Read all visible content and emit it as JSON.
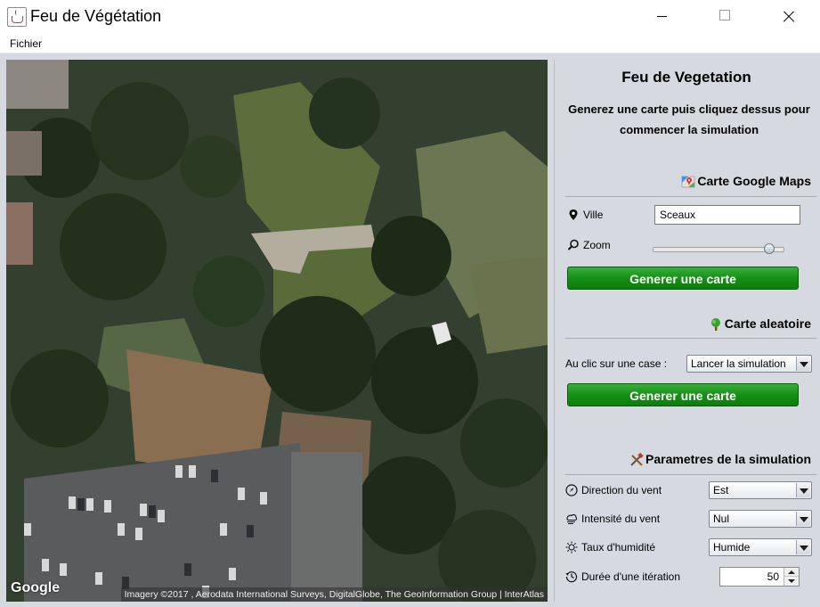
{
  "window": {
    "title": "Feu de Végétation",
    "app_icon": "java-cup-icon",
    "controls": [
      "minimize-icon",
      "maximize-icon",
      "close-icon"
    ]
  },
  "menu": {
    "items": [
      "Fichier"
    ]
  },
  "map": {
    "logo": "Google",
    "attribution": "Imagery ©2017 , Aerodata International Surveys, DigitalGlobe, The GeoInformation Group | InterAtlas"
  },
  "panel": {
    "title": "Feu de Vegetation",
    "description_line1": "Generez une carte puis cliquez dessus pour",
    "description_line2": "commencer la simulation",
    "google_section": {
      "title": "Carte Google Maps",
      "icon": "google-maps-icon",
      "city_label": "Ville",
      "city_value": "Sceaux",
      "zoom_label": "Zoom",
      "zoom_level_fraction": 0.93,
      "button": "Generer une carte"
    },
    "random_section": {
      "title": "Carte aleatoire",
      "icon": "tree-icon",
      "click_label": "Au clic sur une case :",
      "click_value": "Lancer la simulation",
      "button": "Generer une carte"
    },
    "params_section": {
      "title": "Parametres de la simulation",
      "icon": "tools-icon",
      "wind_dir_label": "Direction du vent",
      "wind_dir_value": "Est",
      "wind_int_label": "Intensité du vent",
      "wind_int_value": "Nul",
      "humidity_label": "Taux d'humidité",
      "humidity_value": "Humide",
      "iteration_label": "Durée d'une itération",
      "iteration_value": "50"
    }
  },
  "colors": {
    "button_green": "#169016",
    "panel_bg": "#d6d9df"
  }
}
